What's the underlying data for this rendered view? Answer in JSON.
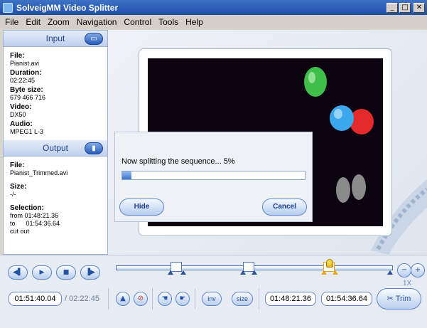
{
  "window": {
    "title": "SolveigMM Video Splitter"
  },
  "menu": [
    "File",
    "Edit",
    "Zoom",
    "Navigation",
    "Control",
    "Tools",
    "Help"
  ],
  "input_panel": {
    "header": "Input",
    "fields": [
      {
        "label": "File:",
        "value": "Pianist.avi"
      },
      {
        "label": "Duration:",
        "value": "02:22:45"
      },
      {
        "label": "Byte size:",
        "value": "679 466 716"
      },
      {
        "label": "Video:",
        "value": "DX50"
      },
      {
        "label": "Audio:",
        "value": "MPEG1 L-3"
      }
    ]
  },
  "output_panel": {
    "header": "Output",
    "file_label": "File:",
    "file_value": "Pianist_Trimmed.avi",
    "size_label": "Size:",
    "size_value": "-/-",
    "selection_label": "Selection:",
    "sel_from": "from 01:48:21.36",
    "sel_to": "to      01:54:36.64",
    "sel_mode": "cut out"
  },
  "dialog": {
    "message": "Now splitting the sequence...  5%",
    "progress": 0.05,
    "hide_label": "Hide",
    "cancel_label": "Cancel"
  },
  "controls": {
    "current_time": "01:51:40.04",
    "total_time": "/ 02:22:45",
    "inv_label": "inv",
    "size_label": "size",
    "marker_start": "01:48:21.36",
    "marker_end": "01:54:36.64",
    "zoom": "1X",
    "trim_label": "Trim"
  }
}
